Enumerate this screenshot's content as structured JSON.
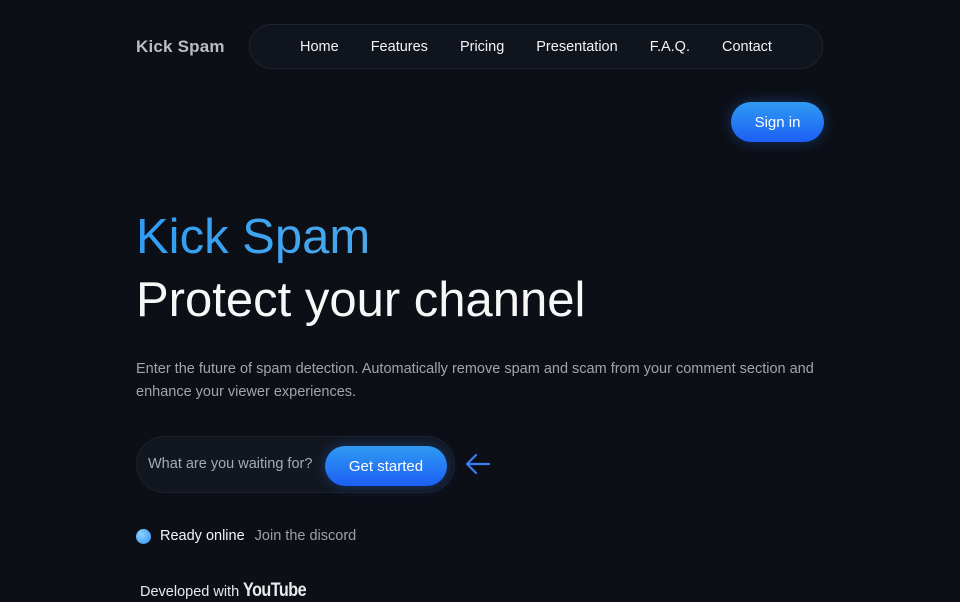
{
  "brand": {
    "name": "Kick Spam"
  },
  "nav": {
    "items": [
      {
        "label": "Home"
      },
      {
        "label": "Features"
      },
      {
        "label": "Pricing"
      },
      {
        "label": "Presentation"
      },
      {
        "label": "F.A.Q."
      },
      {
        "label": "Contact"
      }
    ]
  },
  "header": {
    "signin_label": "Sign in"
  },
  "hero": {
    "title": "Kick Spam",
    "subtitle": "Protect your channel",
    "description": "Enter the future of spam detection. Automatically remove spam and scam from your comment section and enhance your viewer experiences."
  },
  "cta": {
    "prompt": "What are you waiting for?",
    "button_label": "Get started",
    "arrow_icon": "arrow-left-icon"
  },
  "status": {
    "label": "Ready online",
    "link_label": "Join the discord",
    "dot_color": "#3aa2f0"
  },
  "footer_note": {
    "prefix": "Developed with",
    "brand": "YouTube"
  },
  "colors": {
    "accent": "#2f7ff5",
    "background": "#0c0f16"
  }
}
